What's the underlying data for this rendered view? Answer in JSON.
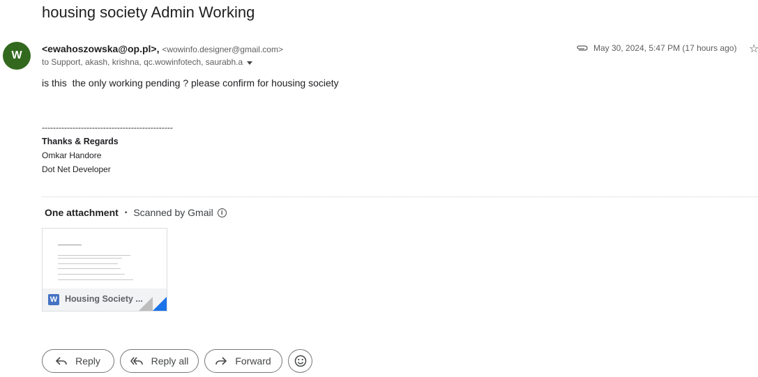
{
  "email": {
    "subject": "housing society Admin Working",
    "avatar_letter": "W",
    "avatar_color": "#33691e",
    "sender_name": "<ewahoszowska@op.pl>,",
    "sender_email": "<wowinfo.designer@gmail.com>",
    "recipients": "to Support, akash, krishna, qc.wowinfotech, saurabh.a",
    "date": "May 30, 2024, 5:47 PM (17 hours ago)",
    "body": "is this  the only working pending ? please confirm for housing society",
    "signature": {
      "separator": "-----------------------------------------------",
      "greeting": "Thanks & Regards",
      "name": "Omkar Handore",
      "title": "Dot Net Developer"
    }
  },
  "attachments": {
    "header": "One attachment",
    "scanned": "Scanned by Gmail",
    "items": [
      {
        "name": "Housing Society ...",
        "icon": "word-doc-icon"
      }
    ]
  },
  "actions": {
    "reply": "Reply",
    "reply_all": "Reply all",
    "forward": "Forward"
  }
}
